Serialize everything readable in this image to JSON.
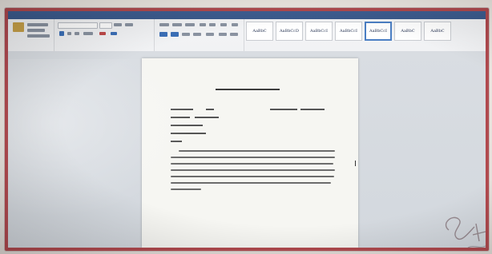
{
  "menu": {
    "items": [
      "",
      "",
      "",
      "",
      "",
      "",
      ""
    ]
  },
  "ribbon": {
    "group_labels": [
      "",
      "",
      "",
      ""
    ],
    "styles": [
      {
        "sample": "AaBbC",
        "name": ""
      },
      {
        "sample": "AaBbCcD",
        "name": ""
      },
      {
        "sample": "AaBbCcI",
        "name": ""
      },
      {
        "sample": "AaBbCcI",
        "name": ""
      },
      {
        "sample": "AaBbCcI",
        "name": "",
        "active": true
      },
      {
        "sample": "AaBbC",
        "name": ""
      },
      {
        "sample": "AaBbC",
        "name": ""
      }
    ],
    "edit_items": [
      "",
      "",
      ""
    ]
  },
  "document": {
    "title": "",
    "lines": [
      "",
      "",
      "",
      "",
      ""
    ]
  },
  "colors": {
    "titlebar": "#3b5a8c",
    "frame": "#b14a4f",
    "selected_style": "#4b7fc4"
  }
}
